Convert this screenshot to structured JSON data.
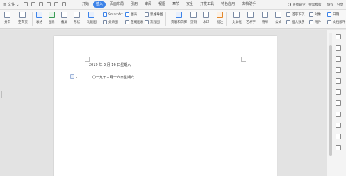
{
  "menubar": {
    "file_label": "文件",
    "tabs": [
      "开始",
      "插入",
      "页面布局",
      "引用",
      "审阅",
      "视图",
      "章节",
      "安全",
      "开发工具",
      "特色应用",
      "文档助手"
    ],
    "active_tab": "插入",
    "search_placeholder": "查找命令、搜索模板",
    "right_items": [
      "协作",
      "分享"
    ]
  },
  "ribbon": {
    "pagebreak": "分页",
    "blankpage": "空白页",
    "table": "表格",
    "picture": "图片",
    "screenshot": "截屏",
    "shape": "形状",
    "iconlib": "功能图",
    "smartart": "SmartArt",
    "chart": "图表",
    "relation": "关系图",
    "online_chart": "在线图表",
    "mindmap": "思维导图",
    "flowchart": "流程图",
    "header_footer": "页眉和页脚",
    "page_number": "页码",
    "watermark": "水印",
    "comment": "批注",
    "textbox": "文本框",
    "wordart": "艺术字",
    "symbol": "符号",
    "formula": "公式",
    "first_drop": "首字下沉",
    "insert_number": "插入数字",
    "object": "对象",
    "date": "日期",
    "attachment": "附件",
    "document_parts": "文档部件"
  },
  "document": {
    "line1": "2019 年 3 月 16 日星期六",
    "line2": "二〇一九年三月十六日星期六"
  }
}
